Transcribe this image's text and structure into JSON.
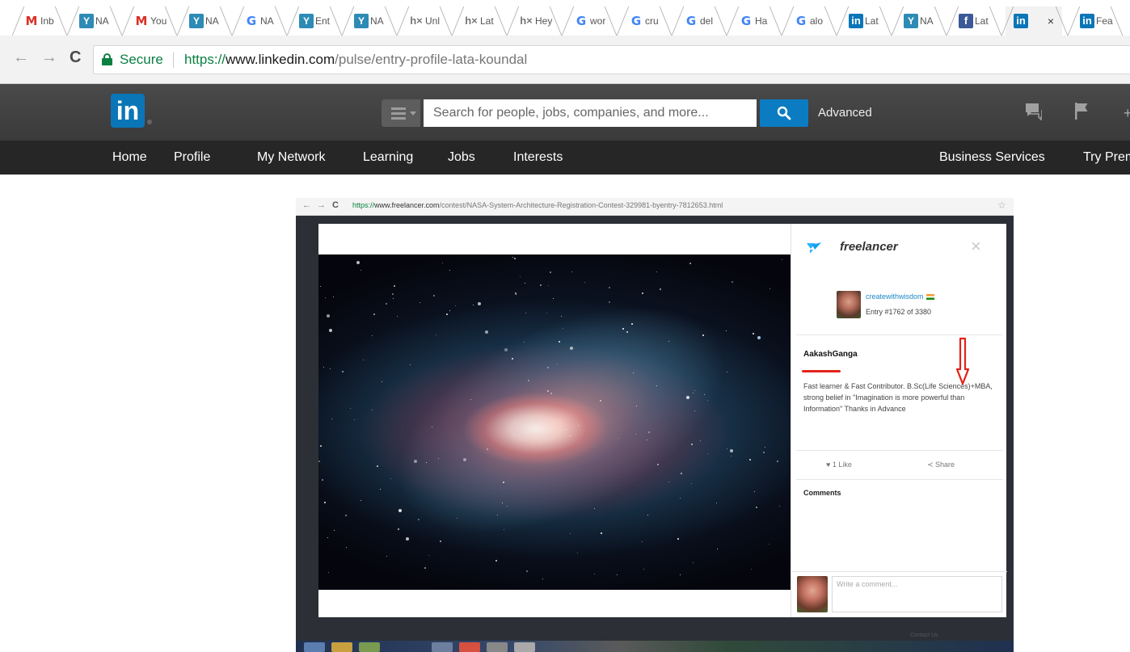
{
  "browser": {
    "tabs": [
      {
        "icon": "gmail-icon",
        "glyph": "M",
        "label": "Inb"
      },
      {
        "icon": "nasa-icon",
        "glyph": "Y",
        "label": "NA"
      },
      {
        "icon": "gmail-icon",
        "glyph": "M",
        "label": "You"
      },
      {
        "icon": "nasa-icon",
        "glyph": "Y",
        "label": "NA"
      },
      {
        "icon": "google-icon",
        "glyph": "G",
        "label": "NA"
      },
      {
        "icon": "nasa-icon",
        "glyph": "Y",
        "label": "Ent"
      },
      {
        "icon": "nasa-icon",
        "glyph": "Y",
        "label": "NA"
      },
      {
        "icon": "hx-icon",
        "glyph": "h×",
        "label": "Unl"
      },
      {
        "icon": "hx-icon",
        "glyph": "h×",
        "label": "Lat"
      },
      {
        "icon": "hx-icon",
        "glyph": "h×",
        "label": "Hey"
      },
      {
        "icon": "google-icon",
        "glyph": "G",
        "label": "wor"
      },
      {
        "icon": "google-icon",
        "glyph": "G",
        "label": "cru"
      },
      {
        "icon": "google-icon",
        "glyph": "G",
        "label": "del"
      },
      {
        "icon": "google-icon",
        "glyph": "G",
        "label": "Ha"
      },
      {
        "icon": "google-icon",
        "glyph": "G",
        "label": "alo"
      },
      {
        "icon": "linkedin-icon",
        "glyph": "in",
        "label": "Lat"
      },
      {
        "icon": "nasa-icon",
        "glyph": "Y",
        "label": "NA"
      },
      {
        "icon": "facebook-icon",
        "glyph": "f",
        "label": "Lat"
      },
      {
        "icon": "linkedin-icon",
        "glyph": "in",
        "label": "",
        "active": true,
        "close": "×"
      },
      {
        "icon": "linkedin-icon",
        "glyph": "in",
        "label": "Fea"
      }
    ],
    "address": {
      "secure_label": "Secure",
      "scheme": "https://",
      "host": "www.linkedin.com",
      "path": "/pulse/entry-profile-lata-koundal"
    },
    "nav": {
      "back": "←",
      "forward": "→",
      "reload": "C"
    }
  },
  "linkedin": {
    "logo": "in",
    "search_placeholder": "Search for people, jobs, companies, and more...",
    "advanced_label": "Advanced",
    "nav_left": [
      "Home",
      "Profile",
      "My Network",
      "Learning",
      "Jobs",
      "Interests"
    ],
    "nav_right": [
      "Business Services",
      "Try Prem"
    ],
    "plus": "+"
  },
  "embedded": {
    "address": {
      "scheme": "https://",
      "host": "www.freelancer.com",
      "path": "/contest/NASA-System-Architecture-Registration-Contest-329981-byentry-7812653.html"
    },
    "brand": "freelancer",
    "close_glyph": "×",
    "user": "createwithwisdom",
    "entry_number": "Entry #1762 of 3380",
    "entry_title": "AakashGanga",
    "entry_description": "Fast learner & Fast Contributor. B.Sc(Life Sciences)+MBA, strong belief in \"Imagination is more powerful than Information\" Thanks in Advance",
    "like_label": "♥ 1 Like",
    "share_label": "≺ Share",
    "comments_label": "Comments",
    "comment_placeholder": "Write a comment...",
    "footer": "Contact Us"
  },
  "colors": {
    "linkedin_blue": "#0a76b7",
    "secure_green": "#0b8043",
    "annotation_red": "#e2231a",
    "link_blue": "#1e88c7"
  }
}
